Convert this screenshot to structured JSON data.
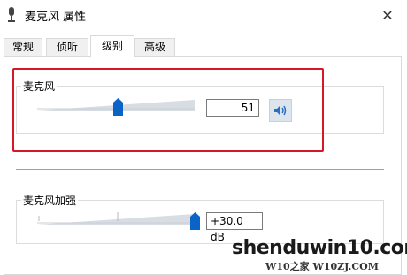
{
  "window": {
    "title": "麦克风 属性",
    "close_glyph": "✕"
  },
  "tabs": [
    {
      "label": "常规",
      "active": false
    },
    {
      "label": "侦听",
      "active": false
    },
    {
      "label": "级别",
      "active": true
    },
    {
      "label": "高级",
      "active": false
    }
  ],
  "microphone": {
    "label": "麦克风",
    "value": "51",
    "level": 51,
    "speaker_icon": "speaker-icon"
  },
  "boost": {
    "label": "麦克风加强",
    "value": "+30.0 dB",
    "level_fraction": 1.0
  },
  "watermark": {
    "main": "shenduwin10.com",
    "sub": "W10之家 W10ZJ.COM"
  },
  "colors": {
    "highlight": "#d6172a",
    "thumb": "#0a64c8"
  }
}
